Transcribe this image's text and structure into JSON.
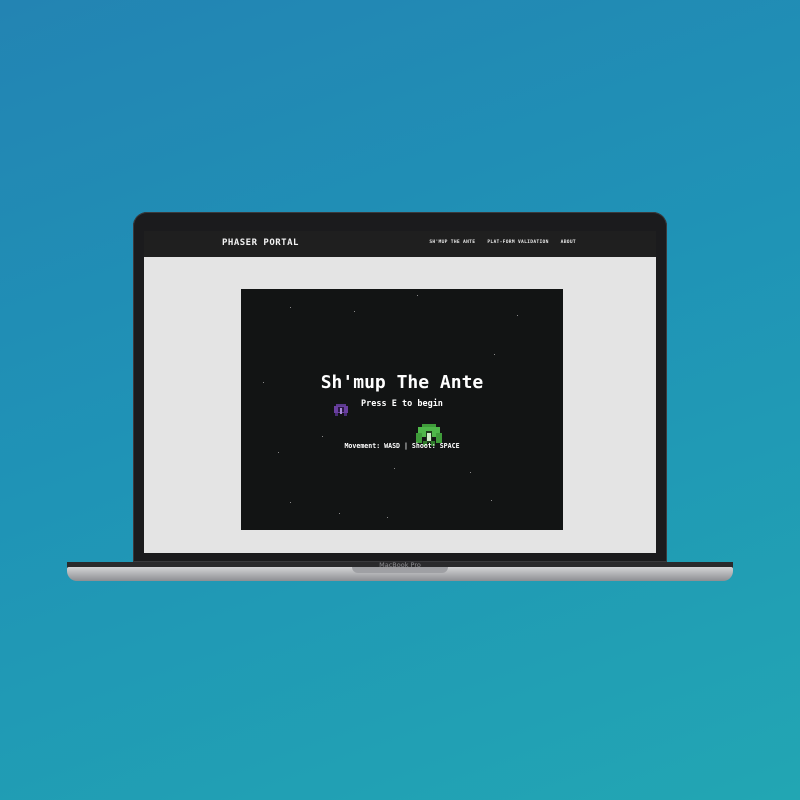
{
  "device": {
    "model_label": "MacBook Pro"
  },
  "site": {
    "brand": "PHASER PORTAL",
    "nav": [
      {
        "label": "SH'MUP THE ANTE"
      },
      {
        "label": "PLAT-FORM VALIDATION"
      },
      {
        "label": "ABOUT"
      }
    ]
  },
  "game": {
    "title": "Sh'mup The Ante",
    "prompt": "Press E to begin",
    "controls": "Movement: WASD | Shoot: SPACE",
    "enemy_sprite": "purple-ship-icon",
    "player_sprite": "green-ship-icon",
    "colors": {
      "background": "#121414",
      "text": "#ffffff",
      "enemy": "#6a3fa0",
      "player": "#4fb84a"
    }
  }
}
